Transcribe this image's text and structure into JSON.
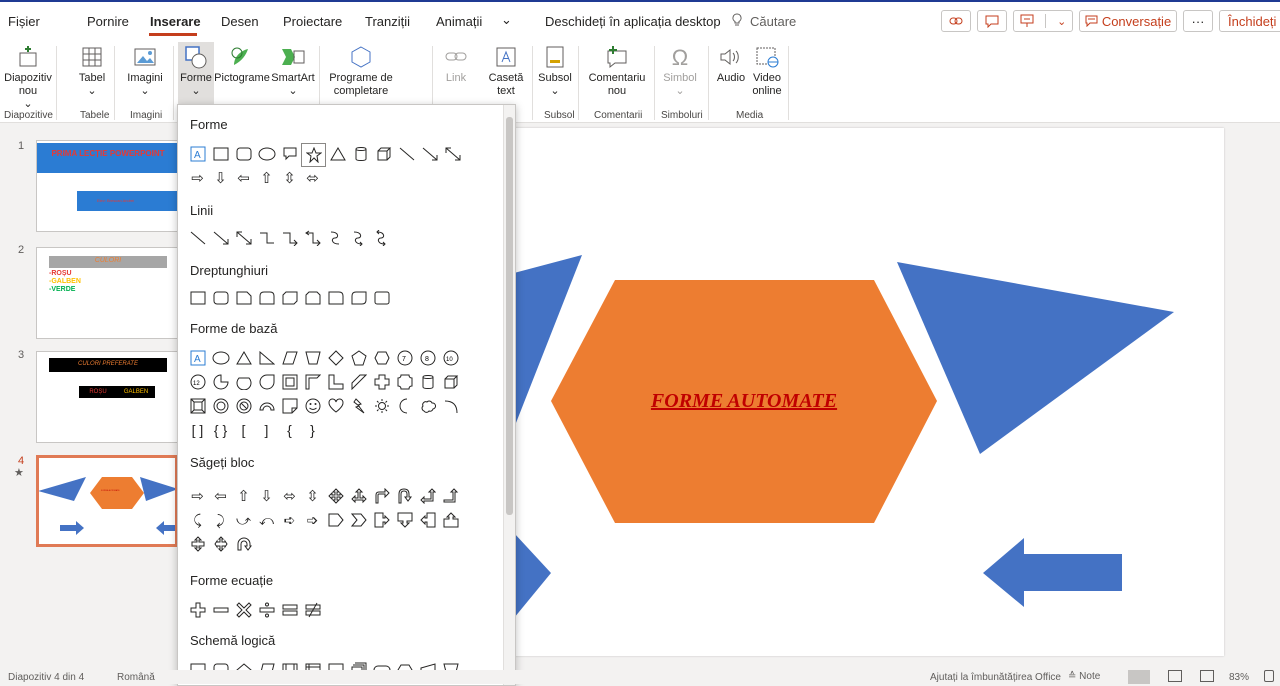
{
  "menu": {
    "items": [
      "Fișier",
      "Pornire",
      "Inserare",
      "Desen",
      "Proiectare",
      "Tranziții",
      "Animații"
    ],
    "more_chevron": "⌄",
    "open_desktop": "Deschideți în aplicația desktop",
    "search_label": "Căutare",
    "conversation": "Conversație",
    "more_dots": "···",
    "close_label": "Închideți"
  },
  "ribbon": {
    "buttons": {
      "new_slide": "Diapozitiv nou",
      "table": "Tabel",
      "images": "Imagini",
      "shapes": "Forme",
      "icons": "Pictograme",
      "smartart": "SmartArt",
      "addins": "Programe de completare",
      "link": "Link",
      "textbox": "Casetă text",
      "footer": "Subsol",
      "comment": "Comentariu nou",
      "symbol": "Simbol",
      "audio": "Audio",
      "video": "Video online"
    },
    "groups": [
      "Diapozitive",
      "Tabele",
      "Imagini",
      "Subsol",
      "Comentarii",
      "Simboluri",
      "Media"
    ]
  },
  "thumbs": [
    {
      "num": "1",
      "title": "PRIMA LECȚIE POWERPOINT",
      "subtitle": "Elev: Brescan Andrei"
    },
    {
      "num": "2",
      "title": "CULORI",
      "list": [
        "-ROȘU",
        "-GALBEN",
        "-VERDE"
      ]
    },
    {
      "num": "3",
      "title": "CULORI PREFERATE",
      "cells": [
        "ROȘU",
        "GALBEN"
      ]
    },
    {
      "num": "4",
      "small": "FORME AUTOMATE",
      "star": "★"
    }
  ],
  "slide": {
    "title": "FORME AUTOMATE"
  },
  "shapes_panel": {
    "sections": [
      "Forme",
      "Linii",
      "Dreptunghiuri",
      "Forme de bază",
      "Săgeți bloc",
      "Forme ecuație",
      "Schemă logică"
    ],
    "textbox_glyph": "A"
  },
  "status": {
    "slide_info": "Diapozitiv 4 din 4",
    "language": "Română",
    "help": "Ajutați la îmbunătățirea Office",
    "notes": "≙ Note",
    "zoom": "83%"
  },
  "colors": {
    "accent": "#c43e1c",
    "blue_shape": "#4472c4",
    "orange_shape": "#ed7d31",
    "slide_title": "#c00000",
    "selected_thumb": "#e07a55"
  }
}
